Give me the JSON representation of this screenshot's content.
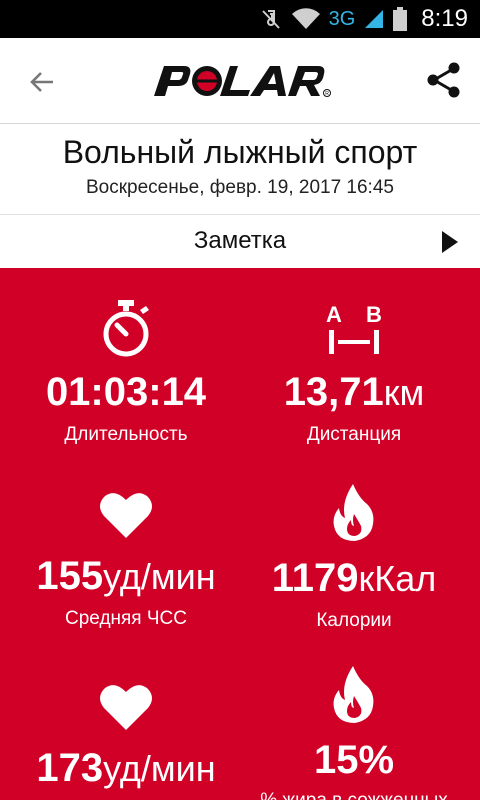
{
  "status_bar": {
    "network": "3G",
    "time": "8:19"
  },
  "app_bar": {
    "logo_text": "POLAR"
  },
  "session": {
    "title": "Вольный лыжный спорт",
    "date": "Воскресенье, февр. 19, 2017 16:45"
  },
  "note": {
    "label": "Заметка"
  },
  "stats": [
    {
      "icon": "stopwatch-icon",
      "value": "01:03:14",
      "unit": "",
      "label": "Длительность"
    },
    {
      "icon": "distance-ab-icon",
      "value": "13,71",
      "unit": "км",
      "label": "Дистанция"
    },
    {
      "icon": "heart-icon",
      "value": "155",
      "unit": "уд/мин",
      "label": "Средняя ЧСС"
    },
    {
      "icon": "flame-icon",
      "value": "1179",
      "unit": "кКал",
      "label": "Калории"
    },
    {
      "icon": "heart-icon",
      "value": "173",
      "unit": "уд/мин",
      "label": ""
    },
    {
      "icon": "flame-icon",
      "value": "15%",
      "unit": "",
      "label": "% жира в сожженных"
    }
  ],
  "colors": {
    "accent": "#d10027",
    "status_bar": "#000000",
    "network_indicator": "#33b5e5"
  }
}
